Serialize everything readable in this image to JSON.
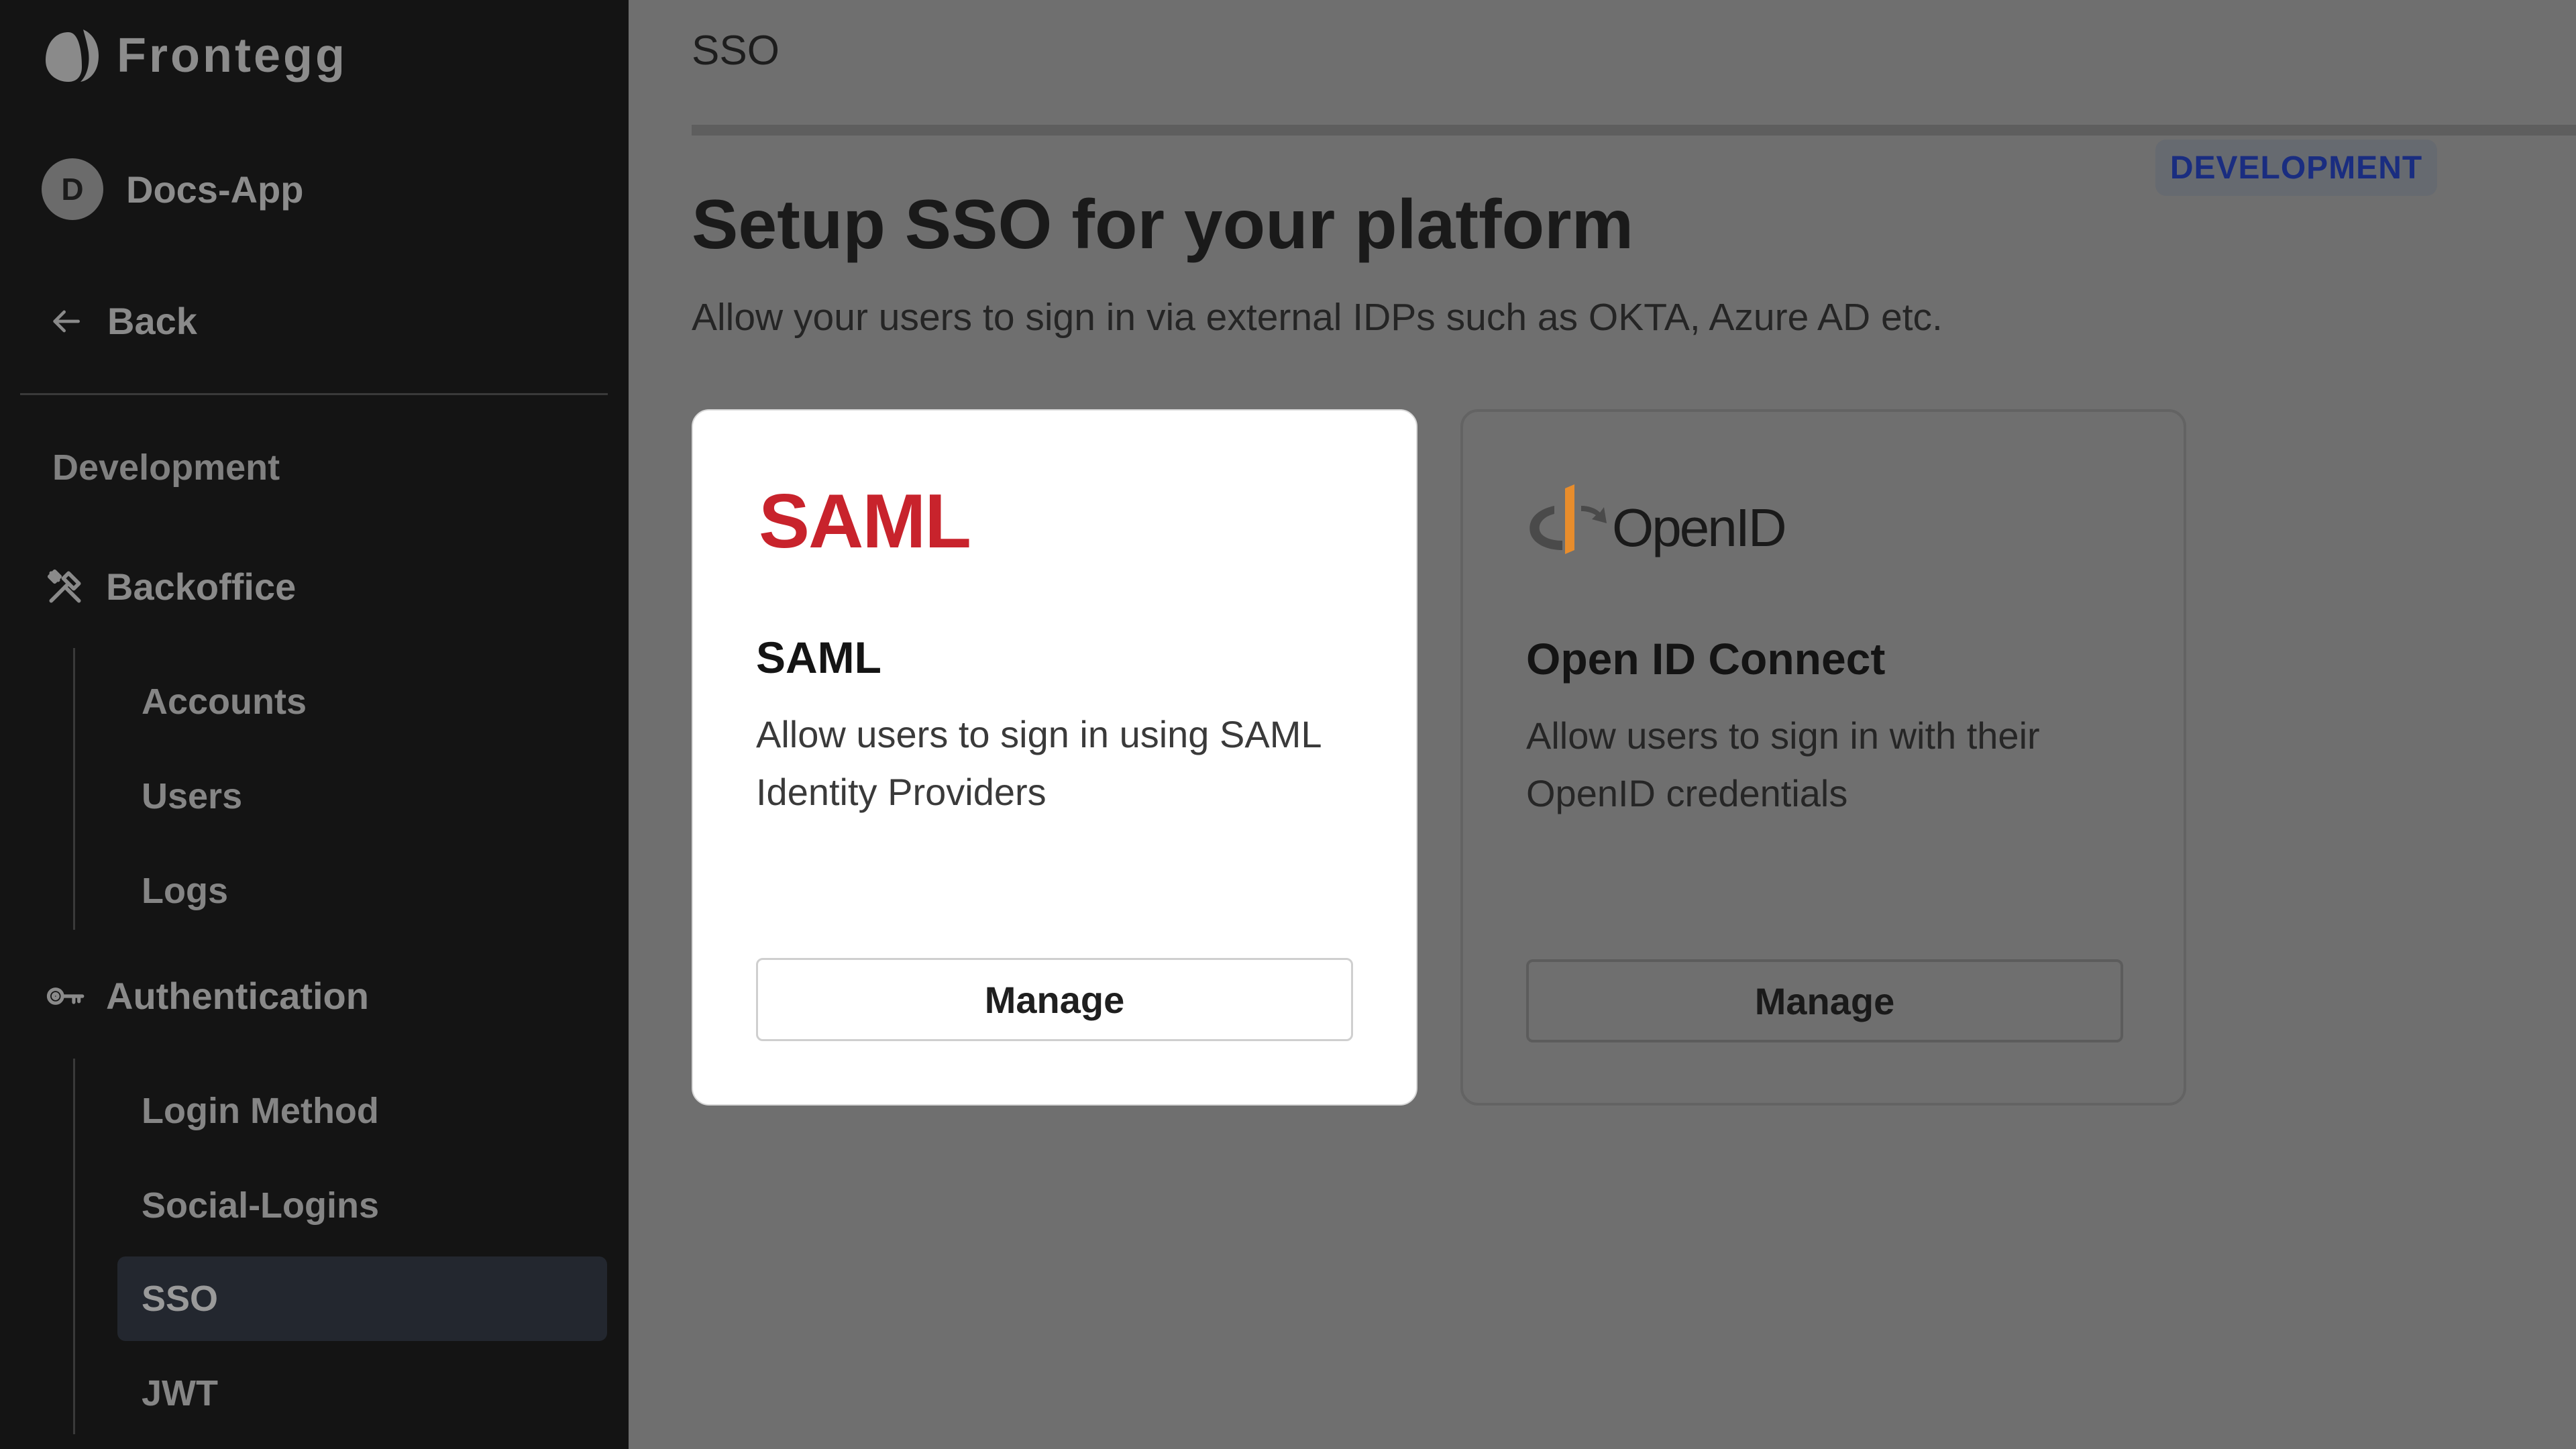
{
  "sidebar": {
    "brand": "Frontegg",
    "app": {
      "avatar_letter": "D",
      "name": "Docs-App"
    },
    "back_label": "Back",
    "section_title": "Development",
    "backoffice": {
      "label": "Backoffice",
      "items": [
        {
          "label": "Accounts"
        },
        {
          "label": "Users"
        },
        {
          "label": "Logs"
        }
      ]
    },
    "authentication": {
      "label": "Authentication",
      "items": [
        {
          "label": "Login Method",
          "active": false
        },
        {
          "label": "Social-Logins",
          "active": false
        },
        {
          "label": "SSO",
          "active": true
        },
        {
          "label": "JWT",
          "active": false
        }
      ]
    }
  },
  "main": {
    "top_title": "SSO",
    "env_badge": "DEVELOPMENT",
    "heading": "Setup SSO for your platform",
    "subheading": "Allow your users to sign in via external IDPs such as OKTA, Azure AD etc.",
    "cards": [
      {
        "logo_text": "SAML",
        "title": "SAML",
        "description": "Allow users to sign in using SAML Identity Providers",
        "button": "Manage"
      },
      {
        "logo_text": "OpenID",
        "title": "Open ID Connect",
        "description": "Allow users to sign in with their OpenID credentials",
        "button": "Manage"
      }
    ]
  },
  "colors": {
    "saml_brand": "#c8232c",
    "openid_orange": "#e88d2c",
    "badge_text": "#1a2d80",
    "sidebar_bg": "#141414",
    "overlay_bg": "#6f6f6f"
  }
}
